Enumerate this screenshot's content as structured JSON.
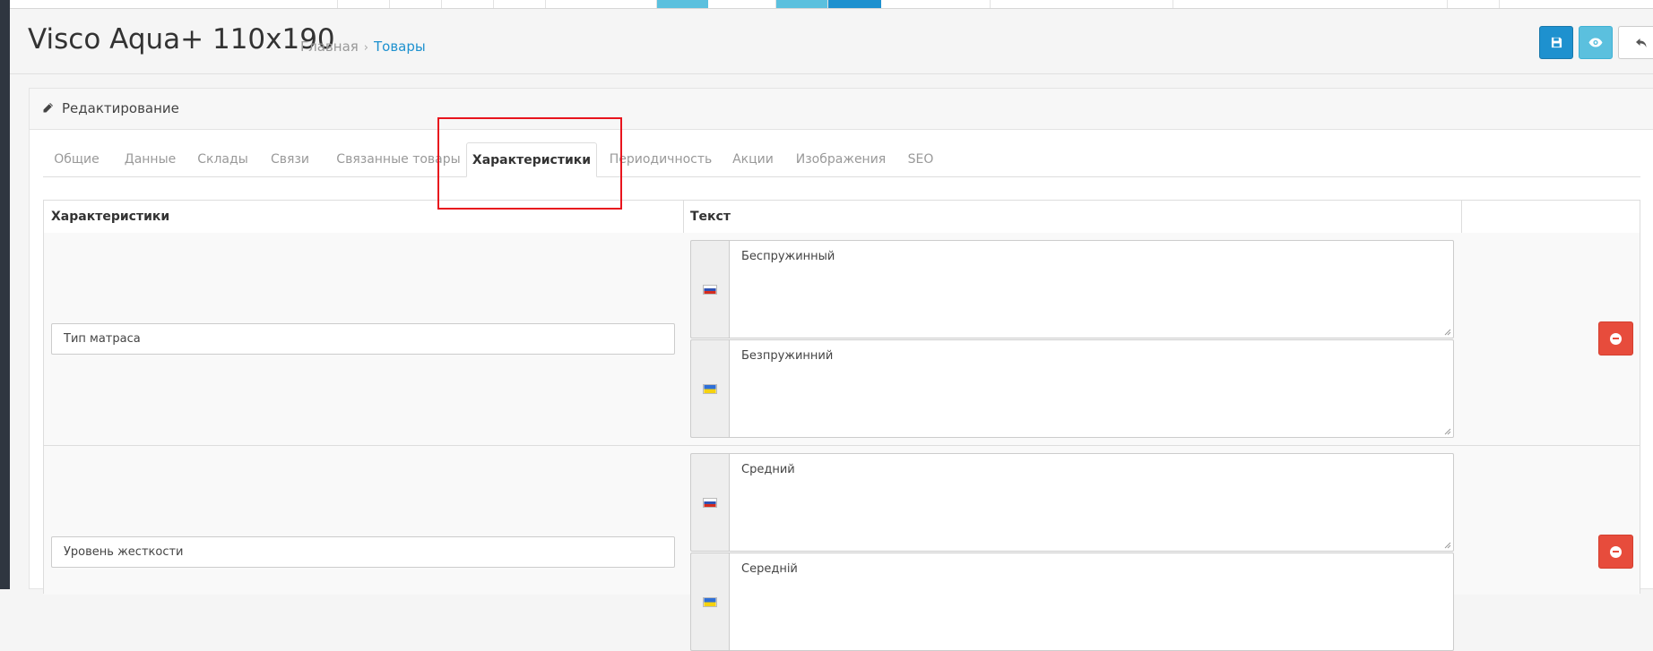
{
  "header": {
    "title": "Visco Aqua+ 110x190",
    "breadcrumb": {
      "home": "Главная",
      "separator": "›",
      "current": "Товары"
    },
    "buttons": {
      "save_icon": "save-icon",
      "view_icon": "eye-icon",
      "back_icon": "reply-icon"
    }
  },
  "panel": {
    "title": "Редактирование",
    "icon": "pencil-icon",
    "tabs": [
      {
        "label": "Общие",
        "active": false
      },
      {
        "label": "Данные",
        "active": false
      },
      {
        "label": "Склады",
        "active": false
      },
      {
        "label": "Связи",
        "active": false
      },
      {
        "label": "Связанные товары",
        "active": false
      },
      {
        "label": "Характеристики",
        "active": true
      },
      {
        "label": "Периодичность",
        "active": false
      },
      {
        "label": "Акции",
        "active": false
      },
      {
        "label": "Изображения",
        "active": false
      },
      {
        "label": "SEO",
        "active": false
      }
    ]
  },
  "table": {
    "headers": [
      "Характеристики",
      "Текст",
      ""
    ],
    "rows": [
      {
        "attribute": "Тип матраса",
        "texts": [
          {
            "lang": "ru",
            "value": "Беспружинный"
          },
          {
            "lang": "uk",
            "value": "Безпружинний"
          }
        ]
      },
      {
        "attribute": "Уровень жесткости",
        "texts": [
          {
            "lang": "ru",
            "value": "Средний"
          },
          {
            "lang": "uk",
            "value": "Середній"
          }
        ]
      }
    ]
  },
  "colors": {
    "primary": "#1e91cf",
    "info": "#5bc0de",
    "danger": "#e74c3c",
    "highlight": "#e8141d"
  }
}
